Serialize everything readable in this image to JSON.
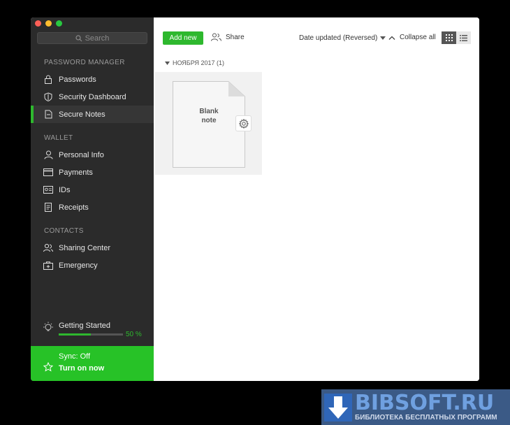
{
  "sidebar": {
    "search_placeholder": "Search",
    "sections": {
      "password_manager": "PASSWORD MANAGER",
      "wallet": "WALLET",
      "contacts": "CONTACTS"
    },
    "items": {
      "passwords": "Passwords",
      "security_dashboard": "Security Dashboard",
      "secure_notes": "Secure Notes",
      "personal_info": "Personal Info",
      "payments": "Payments",
      "ids": "IDs",
      "receipts": "Receipts",
      "sharing_center": "Sharing Center",
      "emergency": "Emergency"
    },
    "getting_started": {
      "label": "Getting Started",
      "progress_percent": 50,
      "percent_text": "50 %"
    },
    "sync": {
      "status": "Sync: Off",
      "action": "Turn on now"
    }
  },
  "toolbar": {
    "add_new": "Add new",
    "share": "Share",
    "sort": "Date updated (Reversed)",
    "collapse_all": "Collapse all"
  },
  "content": {
    "group_title": "НОЯБРЯ 2017 (1)",
    "note_title_line1": "Blank",
    "note_title_line2": "note"
  },
  "watermark": {
    "title": "BIBSOFT.RU",
    "subtitle": "БИБЛИОТЕКА БЕСПЛАТНЫХ ПРОГРАММ"
  },
  "colors": {
    "accent": "#2eb82e",
    "sidebar_bg": "#2b2b2b",
    "sync_bg": "#27c227"
  }
}
